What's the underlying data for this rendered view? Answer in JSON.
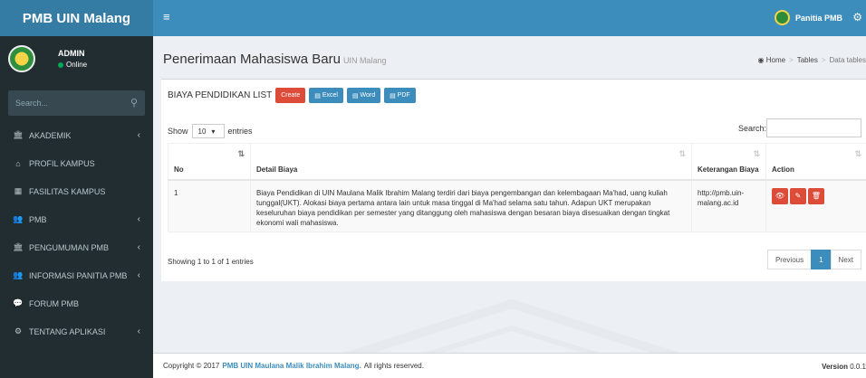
{
  "app": {
    "title": "PMB UIN Malang"
  },
  "topbar": {
    "user": "Panitia PMB"
  },
  "sidebar": {
    "user_name": "ADMIN",
    "user_status": "Online",
    "search_placeholder": "Search...",
    "items": [
      {
        "label": "AKADEMIK",
        "icon": "bank-icon",
        "arrow": true
      },
      {
        "label": "PROFIL KAMPUS",
        "icon": "home-icon",
        "arrow": false
      },
      {
        "label": "FASILITAS KAMPUS",
        "icon": "building-icon",
        "arrow": false
      },
      {
        "label": "PMB",
        "icon": "users-plus-icon",
        "arrow": true
      },
      {
        "label": "PENGUMUMAN PMB",
        "icon": "bank-icon",
        "arrow": true
      },
      {
        "label": "INFORMASI PANITIA PMB",
        "icon": "group-icon",
        "arrow": true
      },
      {
        "label": "FORUM PMB",
        "icon": "comments-icon",
        "arrow": false
      },
      {
        "label": "TENTANG APLIKASI",
        "icon": "gear-icon",
        "arrow": true
      }
    ]
  },
  "header": {
    "title": "Penerimaan Mahasiswa Baru",
    "subtitle": "UIN Malang"
  },
  "breadcrumb": {
    "home": "Home",
    "tables": "Tables",
    "current": "Data tables"
  },
  "box": {
    "title": "BIAYA PENDIDIKAN LIST",
    "buttons": {
      "create": "Create",
      "excel": "Excel",
      "word": "Word",
      "pdf": "PDF"
    },
    "show_label": "Show",
    "entries_value": "10",
    "entries_label": "entries",
    "search_label": "Search:"
  },
  "table": {
    "headers": [
      "No",
      "Detail Biaya",
      "Keterangan Biaya",
      "Action"
    ],
    "rows": [
      {
        "no": "1",
        "detail": "Biaya Pendidikan di UIN Maulana Malik Ibrahim Malang terdiri dari biaya pengembangan dan kelembagaan Ma'had, uang kuliah tunggal(UKT). Alokasi biaya pertama antara lain untuk masa tinggal di Ma'had selama satu tahun. Adapun UKT merupakan keseluruhan biaya pendidikan per semester yang ditanggung oleh mahasiswa dengan besaran biaya disesuaikan dengan tingkat ekonomi wali mahasiswa.",
        "keterangan": "http://pmb.uin-malang.ac.id"
      }
    ]
  },
  "info": "Showing 1 to 1 of 1 entries",
  "pager": {
    "prev": "Previous",
    "page": "1",
    "next": "Next"
  },
  "footer": {
    "copyright": "Copyright © 2017",
    "brand": "PMB UIN Maulana Malik Ibrahim Malang.",
    "rights": "All rights reserved.",
    "version_label": "Version",
    "version_value": "0.0.1"
  },
  "colors": {
    "primary": "#3c8dbc",
    "primary_dark": "#357ca5",
    "danger": "#dd4b39",
    "sidebar": "#222d32"
  }
}
